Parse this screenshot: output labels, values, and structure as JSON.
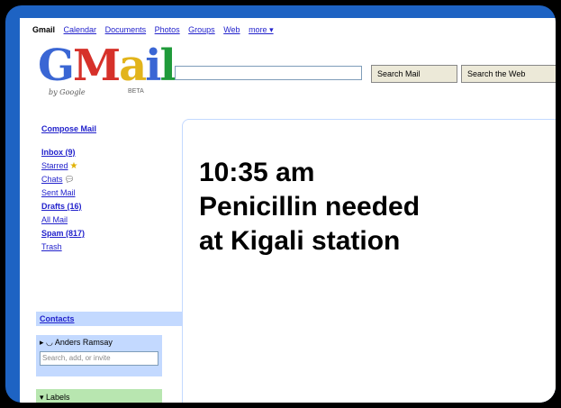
{
  "top_nav": {
    "items": [
      "Gmail",
      "Calendar",
      "Documents",
      "Photos",
      "Groups",
      "Web",
      "more ▾"
    ]
  },
  "logo": {
    "letters": [
      "G",
      "M",
      "a",
      "i",
      "l"
    ],
    "by_google": "by Google",
    "beta": "BETA"
  },
  "search": {
    "value": "",
    "search_mail_label": "Search Mail",
    "search_web_label": "Search the Web"
  },
  "sidebar": {
    "compose": "Compose Mail",
    "items": [
      {
        "label": "Inbox (9)",
        "bold": true
      },
      {
        "label": "Starred",
        "icon": "star-icon"
      },
      {
        "label": "Chats",
        "icon": "chat-bubble-icon"
      },
      {
        "label": "Sent Mail"
      },
      {
        "label": "Drafts (16)",
        "bold": true
      },
      {
        "label": "All Mail"
      },
      {
        "label": "Spam (817)",
        "bold": true
      },
      {
        "label": "Trash"
      }
    ],
    "contacts": "Contacts",
    "quick_contact": {
      "name": "▸ ◡ Anders Ramsay",
      "placeholder": "Search, add, or invite"
    },
    "labels": "▾ Labels"
  },
  "overlay": {
    "line1": "10:35 am",
    "line2": "Penicillin needed",
    "line3": "at Kigali station"
  },
  "colors": {
    "frame_blue": "#1e63c3",
    "link_blue": "#2222cc",
    "contacts_bg": "#c3d9ff",
    "labels_bg": "#b8e6b0"
  }
}
